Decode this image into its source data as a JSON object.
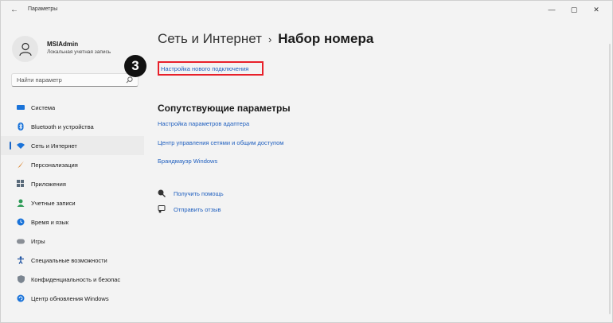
{
  "window": {
    "title": "Параметры",
    "back": "←",
    "minimize": "—",
    "maximize": "▢",
    "close": "✕"
  },
  "user": {
    "name": "MSIAdmin",
    "account": "Локальная учетная запись"
  },
  "search": {
    "placeholder": "Найти параметр"
  },
  "nav": [
    {
      "label": "Система",
      "icon": "system-icon",
      "color": "#1a73d9"
    },
    {
      "label": "Bluetooth и устройства",
      "icon": "bluetooth-icon",
      "color": "#1a73d9"
    },
    {
      "label": "Сеть и Интернет",
      "icon": "network-icon",
      "color": "#1a73d9",
      "active": true
    },
    {
      "label": "Персонализация",
      "icon": "brush-icon",
      "color": "#d9822b"
    },
    {
      "label": "Приложения",
      "icon": "apps-icon",
      "color": "#5a6b7b"
    },
    {
      "label": "Учетные записи",
      "icon": "account-icon",
      "color": "#2e9b57"
    },
    {
      "label": "Время и язык",
      "icon": "clock-icon",
      "color": "#1a73d9"
    },
    {
      "label": "Игры",
      "icon": "gamepad-icon",
      "color": "#8a8f96"
    },
    {
      "label": "Специальные возможности",
      "icon": "accessibility-icon",
      "color": "#1a4fa0"
    },
    {
      "label": "Конфиденциальность и безопас",
      "icon": "shield-icon",
      "color": "#7b8590"
    },
    {
      "label": "Центр обновления Windows",
      "icon": "update-icon",
      "color": "#1a73d9"
    }
  ],
  "main": {
    "breadcrumb_parent": "Сеть и Интернет",
    "breadcrumb_sep": "›",
    "breadcrumb_current": "Набор номера",
    "new_connection": "Настройка нового подключения",
    "step_number": "3",
    "related_title": "Сопутствующие параметры",
    "related_links": [
      "Настройка параметров адаптера",
      "Центр управления сетями и общим доступом",
      "Брандмауэр Windows"
    ],
    "help": "Получить помощь",
    "feedback": "Отправить отзыв"
  },
  "colors": {
    "accent": "#1f5fbf",
    "highlight": "#e8202a"
  }
}
